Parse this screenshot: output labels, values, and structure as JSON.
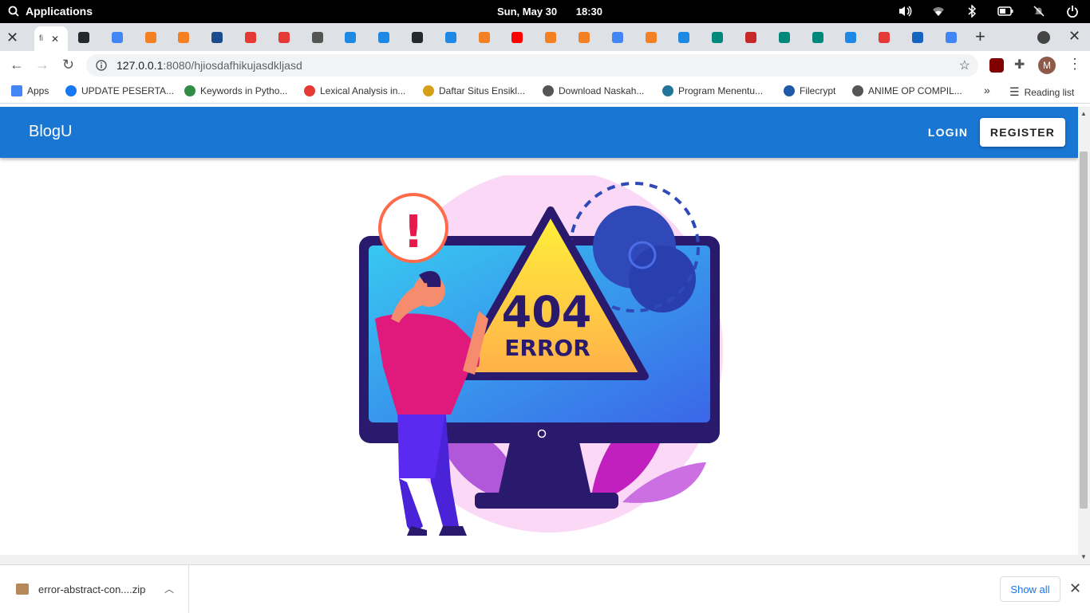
{
  "system_bar": {
    "apps_label": "Applications",
    "date": "Sun, May 30",
    "time": "18:30",
    "tray_icons": [
      "volume-icon",
      "wifi-icon",
      "bluetooth-icon",
      "battery-icon",
      "notifications-off-icon",
      "power-icon"
    ]
  },
  "tabs": {
    "active_title": "fi",
    "icon_colors": [
      "#24292e",
      "#4285f4",
      "#f48024",
      "#f48024",
      "#1a4b8c",
      "#e53935",
      "#e53935",
      "#555555",
      "#1e88e5",
      "#1e88e5",
      "#24292e",
      "#1e88e5",
      "#f48024",
      "#ff0000",
      "#f48024",
      "#f48024",
      "#4285f4",
      "#f48024",
      "#1e88e5",
      "#00897b",
      "#c62828",
      "#00897b",
      "#00897b",
      "#1e88e5",
      "#e53935",
      "#1565c0",
      "#4285f4"
    ],
    "new_tab_label": "+"
  },
  "address_bar": {
    "url_host": "127.0.0.1",
    "url_path": ":8080/hjiosdafhikujasdkljasd",
    "profile_initial": "M"
  },
  "bookmarks": [
    {
      "label": "Apps",
      "color": "#4285f4"
    },
    {
      "label": "UPDATE PESERTA...",
      "color": "#1877f2"
    },
    {
      "label": "Keywords in Pytho...",
      "color": "#2f8d46"
    },
    {
      "label": "Lexical Analysis in...",
      "color": "#e53935"
    },
    {
      "label": "Daftar Situs Ensikl...",
      "color": "#d4a017"
    },
    {
      "label": "Download Naskah...",
      "color": "#555555"
    },
    {
      "label": "Program Menentu...",
      "color": "#21759b"
    },
    {
      "label": "Filecrypt",
      "color": "#1e5aa8"
    },
    {
      "label": "ANIME OP COMPIL...",
      "color": "#555555"
    }
  ],
  "bookmarks_overflow": "»",
  "reading_list": "Reading list",
  "app": {
    "brand": "BlogU",
    "login_label": "LOGIN",
    "register_label": "REGISTER",
    "accent": "#1976d2"
  },
  "illustration": {
    "code": "404",
    "word": "ERROR",
    "alert_mark": "!"
  },
  "downloads": {
    "filename": "error-abstract-con....zip",
    "show_all": "Show all"
  }
}
